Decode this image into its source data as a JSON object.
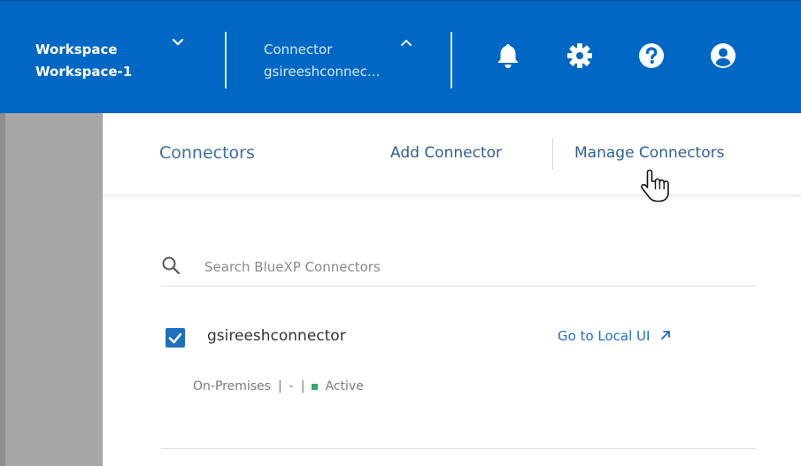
{
  "header": {
    "workspace": {
      "label": "Workspace",
      "value": "Workspace-1",
      "chevron": "chevron-down-icon"
    },
    "connector": {
      "label": "Connector",
      "value": "gsireeshconnec...",
      "chevron": "chevron-up-icon"
    },
    "actions": [
      {
        "name": "notifications",
        "icon": "bell-icon"
      },
      {
        "name": "settings",
        "icon": "gear-icon"
      },
      {
        "name": "help",
        "icon": "question-circle-icon"
      },
      {
        "name": "account",
        "icon": "user-circle-icon"
      }
    ]
  },
  "panel": {
    "title": "Connectors",
    "add_label": "Add Connector",
    "manage_label": "Manage Connectors",
    "search": {
      "placeholder": "Search BlueXP Connectors",
      "value": ""
    },
    "connectors": [
      {
        "name": "gsireeshconnector",
        "checked": true,
        "link_label": "Go to Local UI",
        "location": "On-Premises",
        "separator1": "|",
        "dash": "-",
        "separator2": "|",
        "status": "Active"
      }
    ]
  },
  "colors": {
    "header_bg": "#0067c5",
    "link": "#1f6fbf",
    "rail": "#a7a7a7",
    "status_active": "#3aa874"
  }
}
